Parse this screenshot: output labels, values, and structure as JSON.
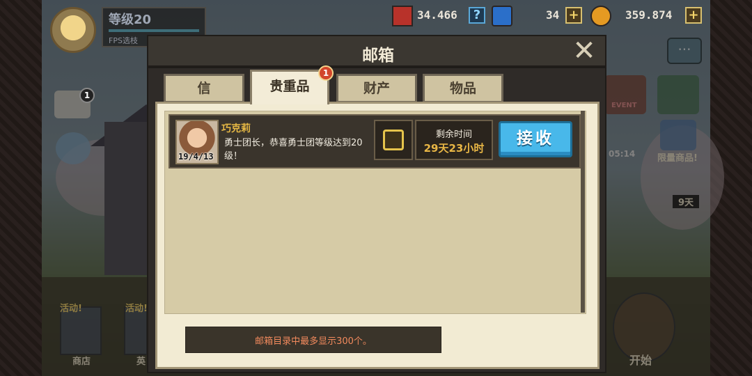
{
  "hud": {
    "level": "等级20",
    "level_sub": "FPS选枝",
    "resources": [
      {
        "icon": "medal-icon",
        "value": "34.466",
        "extra": "?"
      },
      {
        "icon": "gem-icon",
        "value": "34",
        "extra": "+"
      },
      {
        "icon": "gold-coin-icon",
        "value": "359.874",
        "extra": "+"
      }
    ]
  },
  "side": {
    "event_label": "EVENT",
    "limited_goods": "限量商品!",
    "timer": "05:14",
    "days": "9天",
    "mail_count": "1"
  },
  "bottom": {
    "activity1": "活动!",
    "activity2": "活动!",
    "shop": "商店",
    "start": "开始",
    "partial": "英"
  },
  "mailbox": {
    "title": "邮箱",
    "tabs": [
      {
        "label": "信",
        "active": false
      },
      {
        "label": "贵重品",
        "active": true,
        "badge": "1"
      },
      {
        "label": "财产",
        "active": false
      },
      {
        "label": "物品",
        "active": false
      }
    ],
    "mails": [
      {
        "sender": "巧克莉",
        "date": "19/4/13",
        "message": "勇士团长，恭喜勇士团等级达到20级！",
        "remaining_label": "剩余时间",
        "remaining_value": "29天23小时",
        "accept_label": "接收"
      }
    ],
    "notice": "邮箱目录中最多显示300个。"
  },
  "colors": {
    "accent_blue": "#48b8ea",
    "gold_text": "#e8b645",
    "notice_text": "#f28a5d",
    "badge_red": "#d2462b"
  }
}
